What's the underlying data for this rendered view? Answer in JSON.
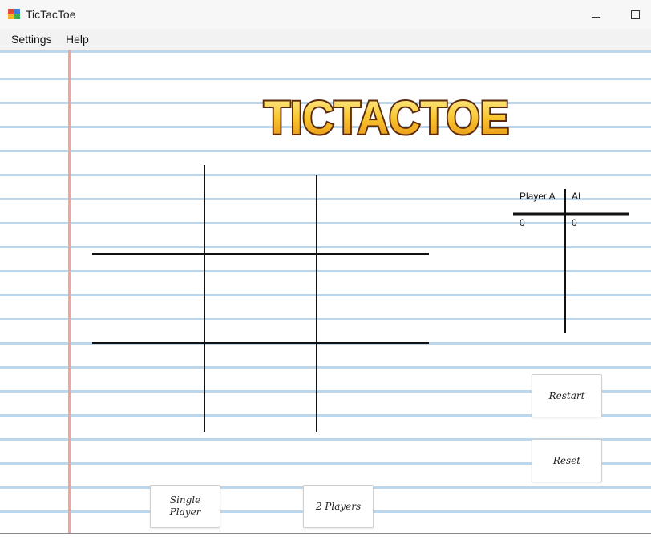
{
  "window": {
    "title": "TicTacToe",
    "icon": "app-grid-icon"
  },
  "menu": {
    "items": [
      "Settings",
      "Help"
    ]
  },
  "logo": {
    "text": "TICTACTOE"
  },
  "scoreboard": {
    "player_a_label": "Player A",
    "ai_label": "AI",
    "player_a_score": "0",
    "ai_score": "0"
  },
  "buttons": {
    "restart": "Restart",
    "reset": "Reset",
    "single_player": "Single\nPlayer",
    "two_players": "2 Players"
  },
  "colors": {
    "paper_line": "#bcd6ec",
    "margin_line": "#f3a49c",
    "logo_fill": "#f7c52e",
    "logo_outline": "#5a2a0c"
  }
}
